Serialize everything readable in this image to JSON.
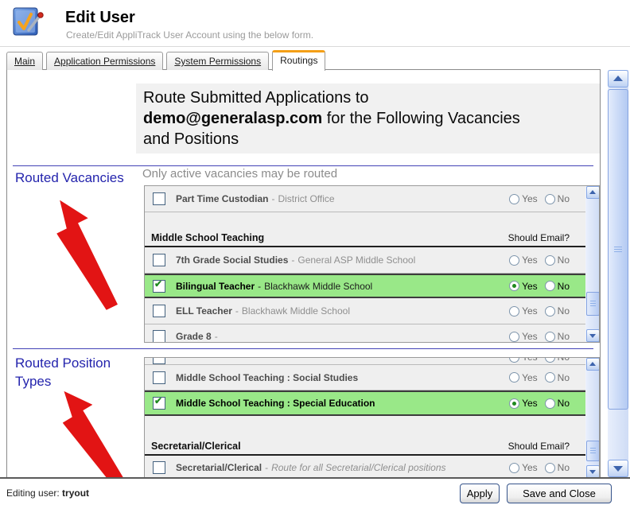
{
  "window": {
    "title": "Edit User",
    "subtitle": "Create/Edit AppliTrack User Account using the below form."
  },
  "tabs": [
    {
      "label": "Main",
      "active": false
    },
    {
      "label": "Application Permissions",
      "active": false
    },
    {
      "label": "System Permissions",
      "active": false
    },
    {
      "label": "Routings",
      "active": true
    }
  ],
  "heading": {
    "pre": "Route Submitted Applications to ",
    "email": "demo@generalasp.com",
    "post": " for the Following Vacancies and Positions"
  },
  "note": "Only active vacancies may be routed",
  "labels": {
    "yes": "Yes",
    "no": "No",
    "dash": "-"
  },
  "sections": {
    "vacancies": {
      "label": "Routed Vacancies",
      "rows": {
        "part_time_custodian": {
          "name": "Part Time Custodian",
          "location": "District Office"
        },
        "group_mst": {
          "name": "Middle School Teaching",
          "right": "Should Email?"
        },
        "seventh_grade": {
          "name": "7th Grade Social Studies",
          "location": "General ASP Middle School"
        },
        "bilingual": {
          "name": "Bilingual Teacher",
          "location": "Blackhawk Middle School"
        },
        "ell": {
          "name": "ELL Teacher",
          "location": "Blackhawk Middle School"
        },
        "grade8": {
          "name": "Grade 8",
          "location": ""
        }
      }
    },
    "positions": {
      "label": "Routed Position Types",
      "rows": {
        "social_studies": {
          "name": "Middle School Teaching : Social Studies"
        },
        "special_ed": {
          "name": "Middle School Teaching : Special Education"
        },
        "group_sec": {
          "name": "Secretarial/Clerical",
          "right": "Should Email?"
        },
        "secretarial": {
          "name": "Secretarial/Clerical",
          "desc": "Route for all Secretarial/Clerical positions"
        }
      }
    }
  },
  "footer": {
    "editing_label": "Editing user:",
    "editing_user": "tryout",
    "apply": "Apply",
    "save_and_close": "Save and Close"
  },
  "colors": {
    "highlight_green": "#99e888",
    "label_blue": "#2424ad",
    "arrow_red": "#e21414",
    "tab_orange": "#f49f17",
    "divider_blue": "#4343b6"
  }
}
